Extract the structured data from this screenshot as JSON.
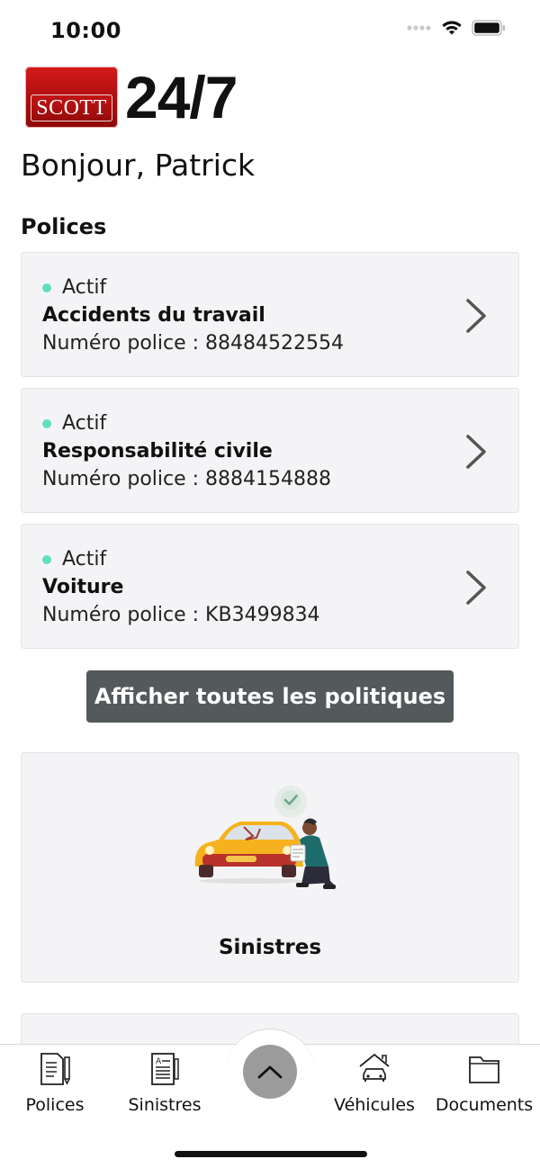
{
  "status_bar": {
    "time": "10:00",
    "icons": [
      "cellular-dots-icon",
      "wifi-icon",
      "battery-icon"
    ]
  },
  "brand": {
    "logo_text": "SCOTT",
    "tagline": "24/7",
    "colors": {
      "logo_red": "#c41414"
    }
  },
  "greeting": "Bonjour, Patrick",
  "policies_section": {
    "title": "Polices",
    "items": [
      {
        "status": "Actif",
        "name": "Accidents du travail",
        "number": "Numéro police : 88484522554"
      },
      {
        "status": "Actif",
        "name": "Responsabilité civile",
        "number": "Numéro police : 8884154888"
      },
      {
        "status": "Actif",
        "name": "Voiture",
        "number": "Numéro police : KB3499834"
      }
    ],
    "status_color": "#5fe0c3",
    "show_all_label": "Afficher toutes les politiques"
  },
  "claims_card": {
    "title": "Sinistres",
    "illustration": "car-damage-inspection-illustration"
  },
  "tabbar": {
    "tabs": [
      {
        "label": "Polices",
        "icon": "policy-document-icon"
      },
      {
        "label": "Sinistres",
        "icon": "claim-form-icon"
      },
      {
        "label": "Véhicules",
        "icon": "car-garage-icon"
      },
      {
        "label": "Documents",
        "icon": "folder-icon"
      }
    ],
    "center_button_icon": "chevron-up-icon"
  }
}
